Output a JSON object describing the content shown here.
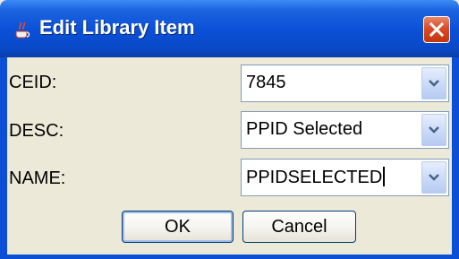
{
  "window": {
    "title": "Edit Library Item",
    "icons": {
      "app": "java-coffee-cup-icon",
      "close": "close-icon"
    }
  },
  "form": {
    "fields": [
      {
        "label": "CEID:",
        "value": "7845"
      },
      {
        "label": "DESC:",
        "value": "PPID Selected"
      },
      {
        "label": "NAME:",
        "value": "PPIDSELECTED"
      }
    ]
  },
  "buttons": {
    "ok": "OK",
    "cancel": "Cancel"
  },
  "colors": {
    "titlebar": "#0a4fd6",
    "close": "#d94b24",
    "panel": "#ece9d8"
  }
}
